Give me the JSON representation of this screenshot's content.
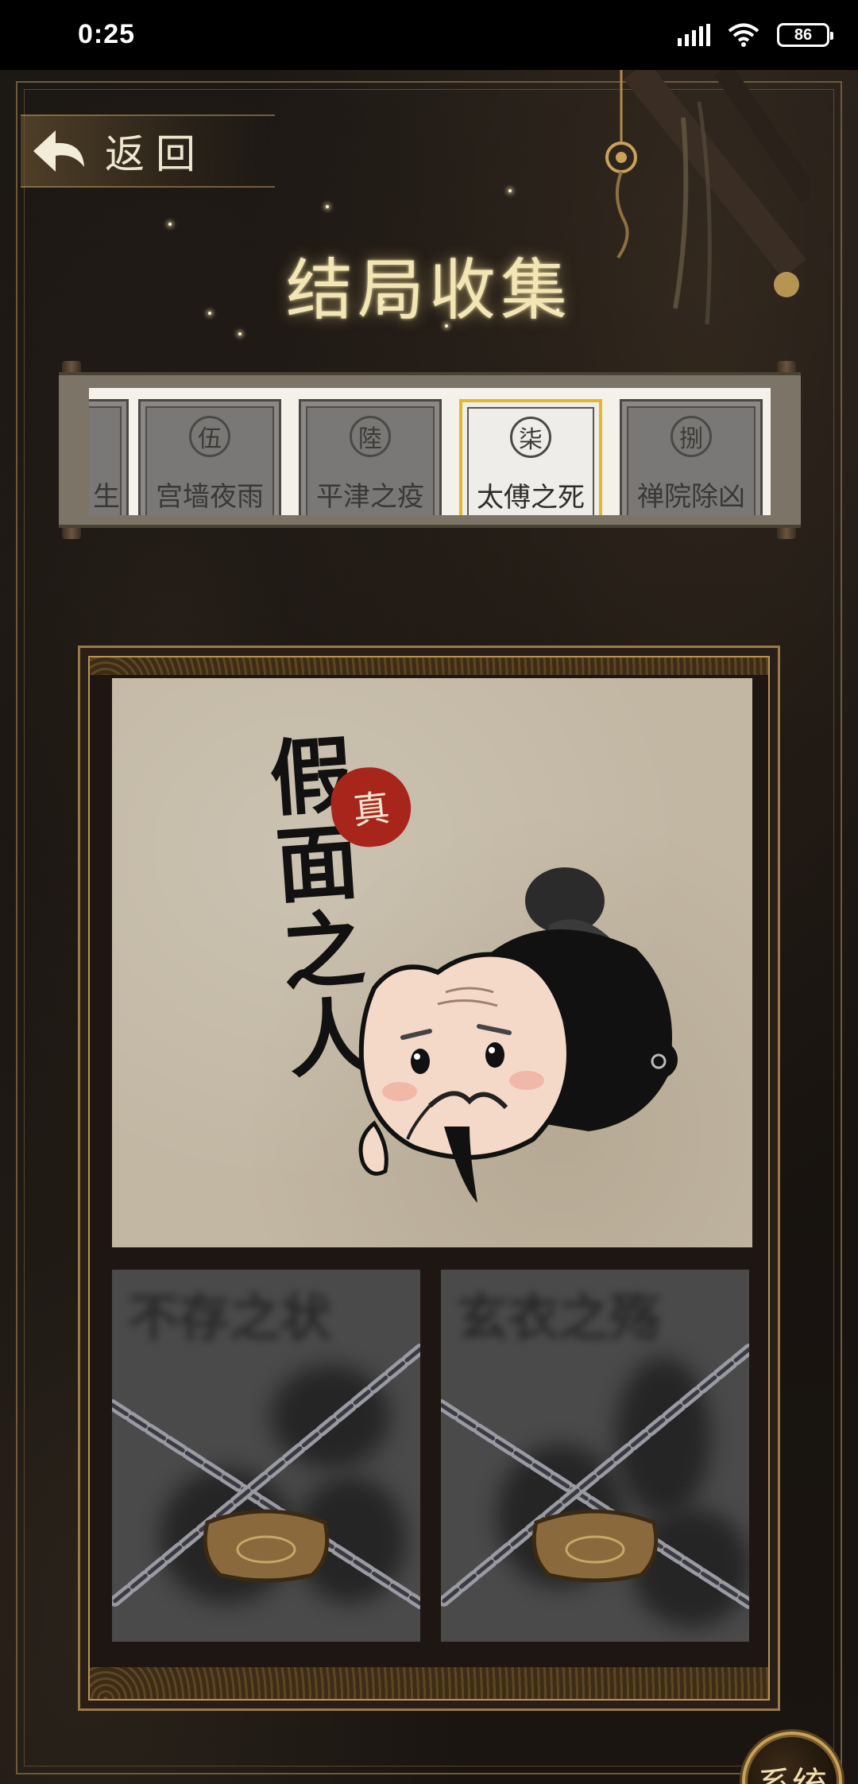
{
  "status_bar": {
    "time": "0:25",
    "battery": "86"
  },
  "header": {
    "back_label": "返回",
    "title": "结局收集"
  },
  "chapter_tabs": [
    {
      "seal": "",
      "label": "生",
      "selected": false
    },
    {
      "seal": "伍",
      "label": "宫墙夜雨",
      "selected": false
    },
    {
      "seal": "陸",
      "label": "平津之疫",
      "selected": false
    },
    {
      "seal": "柒",
      "label": "太傅之死",
      "selected": true
    },
    {
      "seal": "捌",
      "label": "禅院除凶",
      "selected": false
    }
  ],
  "featured_ending": {
    "title": "假面之人",
    "seal": "真",
    "unlocked": true
  },
  "locked_endings": [
    {
      "title": "不存之状",
      "unlocked": false
    },
    {
      "title": "玄衣之殇",
      "unlocked": false
    }
  ],
  "system_button": {
    "label": "系统"
  },
  "colors": {
    "background": "#15110e",
    "gold": "#c9a25a",
    "title_glow": "#f3e6b5",
    "tab_active_border": "#e6b629",
    "seal_red": "#a8251c"
  }
}
